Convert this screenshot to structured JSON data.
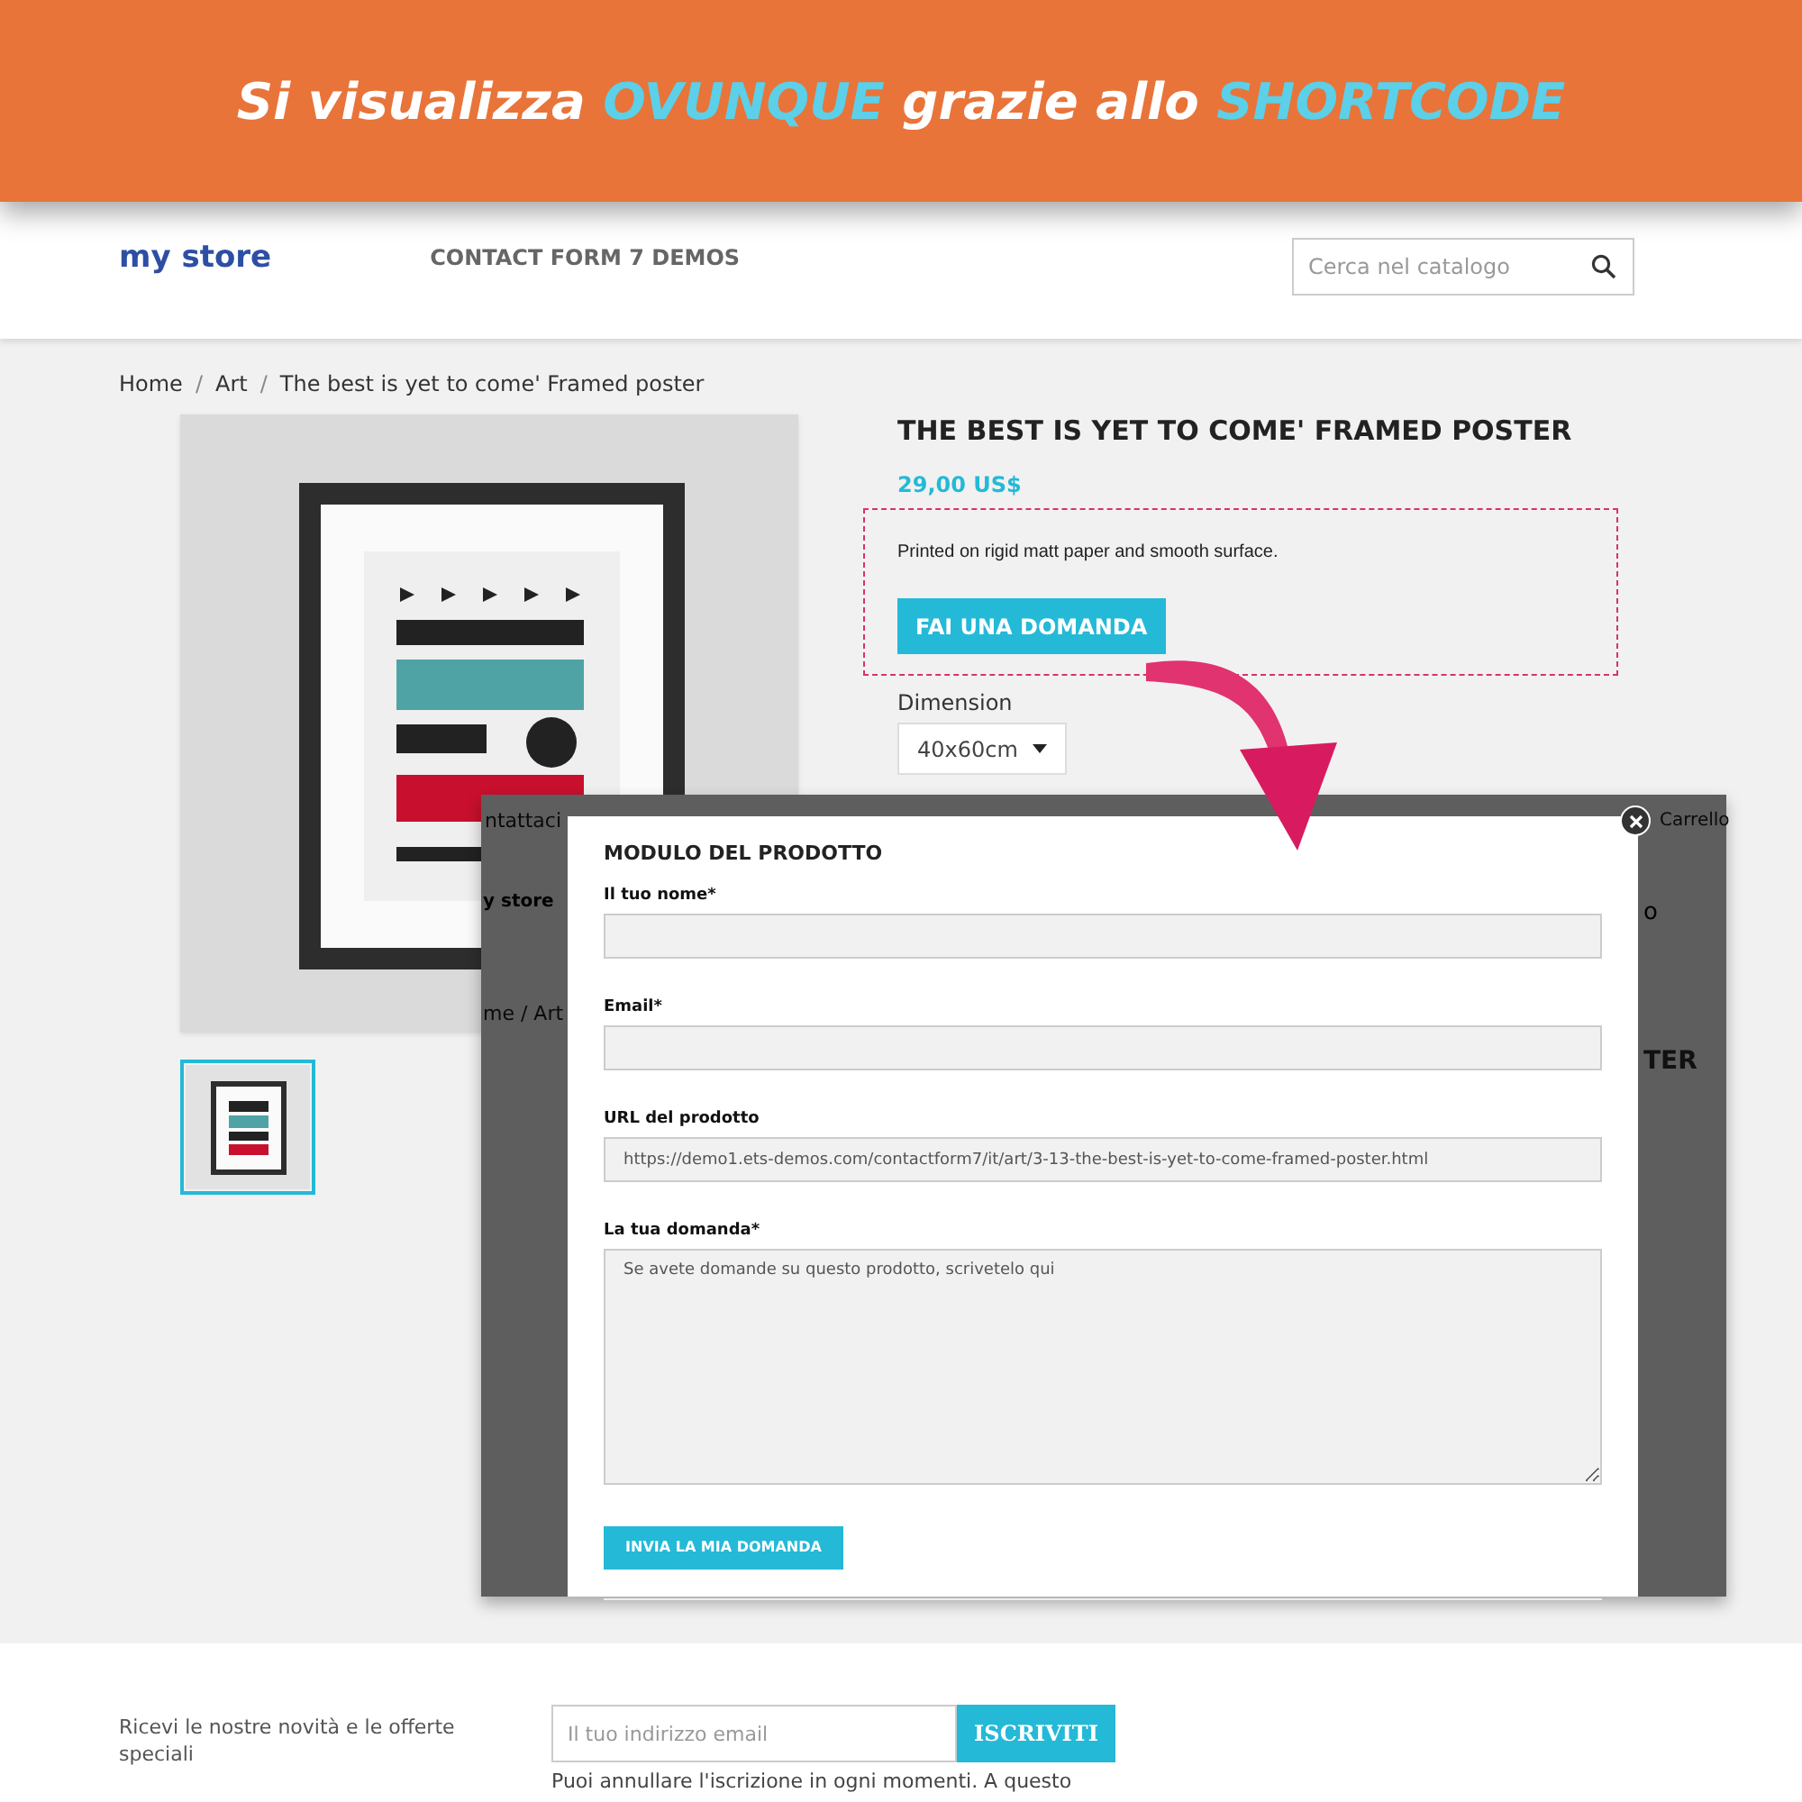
{
  "banner": {
    "segments": [
      {
        "text": "Si visualizza ",
        "highlight": false
      },
      {
        "text": "OVUNQUE",
        "highlight": true
      },
      {
        "text": " grazie allo ",
        "highlight": false
      },
      {
        "text": "SHORTCODE",
        "highlight": true
      }
    ]
  },
  "header": {
    "logo": "my store",
    "nav": [
      "CONTACT FORM 7 DEMOS"
    ],
    "search": {
      "placeholder": "Cerca nel catalogo"
    }
  },
  "breadcrumb": {
    "separator": "/",
    "items": [
      "Home",
      "Art",
      "The best is yet to come' Framed poster"
    ]
  },
  "product": {
    "title": "THE BEST IS YET TO COME' FRAMED POSTER",
    "price": "29,00 US$",
    "description": "Printed on rigid matt paper and smooth surface.",
    "ask_button": "FAI UNA DOMANDA",
    "option": {
      "label": "Dimension",
      "value": "40x60cm"
    },
    "thumbnails": [
      {
        "kind": "picture",
        "selected": true
      }
    ]
  },
  "dimmed_page": {
    "nav_link": "ntattaci",
    "cart_link": "Carrello",
    "logo": "y store",
    "search_fragment": "o",
    "breadcrumb": "me / Art",
    "title_fragment": "TER"
  },
  "modal": {
    "title": "MODULO DEL PRODOTTO",
    "fields": [
      {
        "label": "Il tuo nome*",
        "kind": "input"
      },
      {
        "label": "Email*",
        "kind": "input"
      },
      {
        "label": "URL del prodotto",
        "kind": "input",
        "value": "https://demo1.ets-demos.com/contactform7/it/art/3-13-the-best-is-yet-to-come-framed-poster.html"
      },
      {
        "label": "La tua domanda*",
        "kind": "textarea",
        "placeholder": "Se avete domande su questo prodotto, scrivetelo qui"
      }
    ],
    "submit": "INVIA LA MIA DOMANDA"
  },
  "newsletter": {
    "text": "Ricevi le nostre novità e le offerte speciali",
    "placeholder": "Il tuo indirizzo email",
    "button": "ISCRIVITI",
    "note": "Puoi annullare l'iscrizione in ogni momenti. A questo"
  }
}
